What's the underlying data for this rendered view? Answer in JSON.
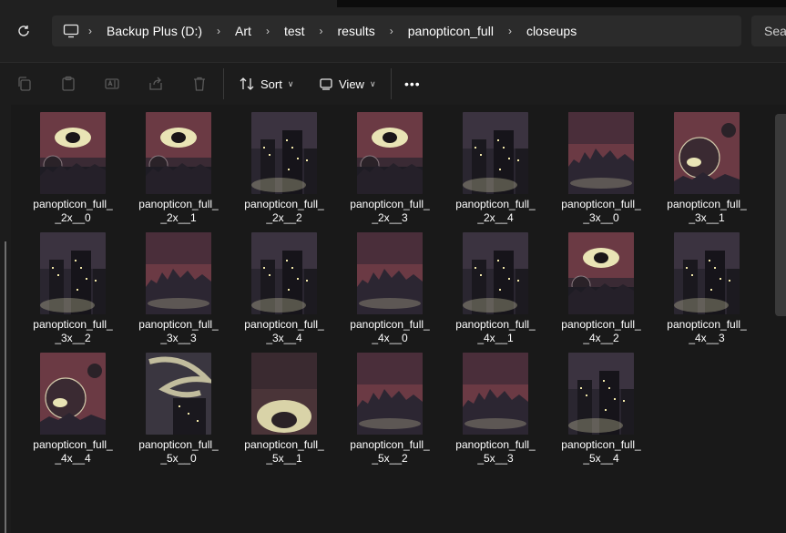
{
  "breadcrumbs": [
    "Backup Plus (D:)",
    "Art",
    "test",
    "results",
    "panopticon_full",
    "closeups"
  ],
  "search": {
    "placeholder": "Sear"
  },
  "toolbar": {
    "sort_label": "Sort",
    "view_label": "View",
    "more_label": "•••"
  },
  "files": [
    {
      "l1": "panopticon_full_",
      "l2": "_2x__0",
      "style": "eye"
    },
    {
      "l1": "panopticon_full_",
      "l2": "_2x__1",
      "style": "eye"
    },
    {
      "l1": "panopticon_full_",
      "l2": "_2x__2",
      "style": "city"
    },
    {
      "l1": "panopticon_full_",
      "l2": "_2x__3",
      "style": "eye"
    },
    {
      "l1": "panopticon_full_",
      "l2": "_2x__4",
      "style": "city"
    },
    {
      "l1": "panopticon_full_",
      "l2": "_3x__0",
      "style": "sky"
    },
    {
      "l1": "panopticon_full_",
      "l2": "_3x__1",
      "style": "orb"
    },
    {
      "l1": "panopticon_full_",
      "l2": "_3x__2",
      "style": "city"
    },
    {
      "l1": "panopticon_full_",
      "l2": "_3x__3",
      "style": "sky"
    },
    {
      "l1": "panopticon_full_",
      "l2": "_3x__4",
      "style": "city"
    },
    {
      "l1": "panopticon_full_",
      "l2": "_4x__0",
      "style": "sky"
    },
    {
      "l1": "panopticon_full_",
      "l2": "_4x__1",
      "style": "city"
    },
    {
      "l1": "panopticon_full_",
      "l2": "_4x__2",
      "style": "eye"
    },
    {
      "l1": "panopticon_full_",
      "l2": "_4x__3",
      "style": "city"
    },
    {
      "l1": "panopticon_full_",
      "l2": "_4x__4",
      "style": "orb"
    },
    {
      "l1": "panopticon_full_",
      "l2": "_5x__0",
      "style": "swirl"
    },
    {
      "l1": "panopticon_full_",
      "l2": "_5x__1",
      "style": "glow"
    },
    {
      "l1": "panopticon_full_",
      "l2": "_5x__2",
      "style": "sky"
    },
    {
      "l1": "panopticon_full_",
      "l2": "_5x__3",
      "style": "sky"
    },
    {
      "l1": "panopticon_full_",
      "l2": "_5x__4",
      "style": "city"
    }
  ],
  "colors": {
    "background": "#191919",
    "toolbar": "#1c1c1c",
    "address_bar": "#2b2b2b",
    "maroon": "#6b3a44",
    "dark_sky": "#2a2630",
    "glow": "#e8e4b8"
  }
}
